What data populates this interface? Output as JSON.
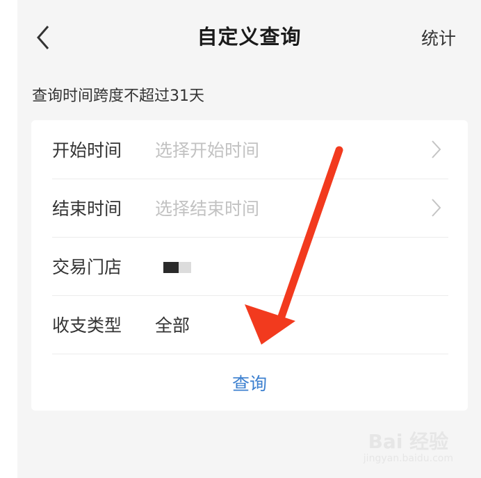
{
  "nav": {
    "title": "自定义查询",
    "right_action": "统计"
  },
  "hint": "查询时间跨度不超过31天",
  "form": {
    "rows": [
      {
        "label": "开始时间",
        "value": "选择开始时间"
      },
      {
        "label": "结束时间",
        "value": "选择结束时间"
      },
      {
        "label": "交易门店"
      },
      {
        "label": "收支类型",
        "value": "全部"
      }
    ],
    "query_button": "查询"
  },
  "colors": {
    "page_bg": "#f5f5f5",
    "card_bg": "#ffffff",
    "accent": "#3b7fcf",
    "placeholder": "#c2c2c2",
    "annotation_arrow": "#f23a1e"
  },
  "icons": {
    "back": "chevron-left-icon",
    "row_arrow": "chevron-right-icon"
  },
  "watermark": {
    "brand": "Bai 经验",
    "url": "jingyan.baidu.com"
  }
}
